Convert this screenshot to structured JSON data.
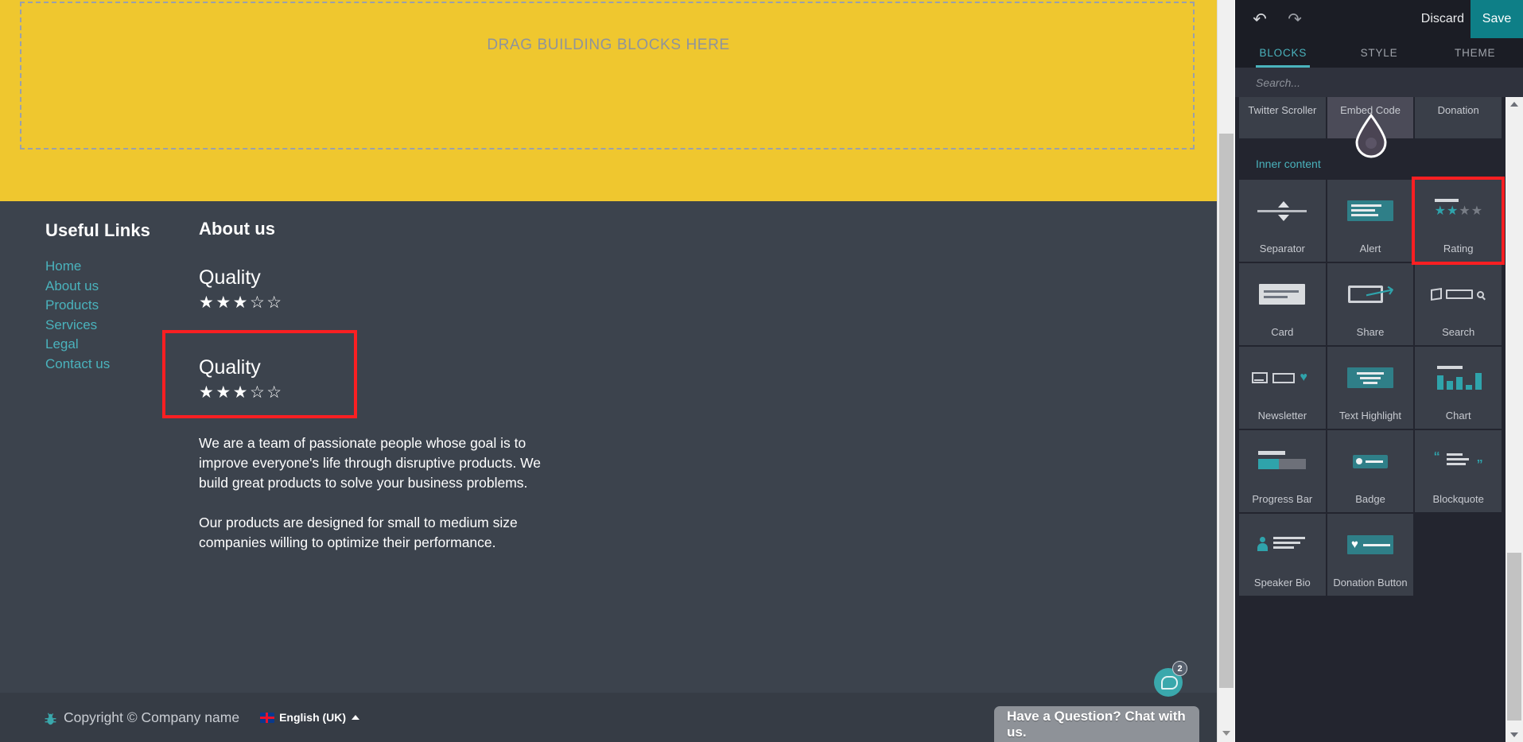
{
  "editor": {
    "toolbar": {
      "undo_icon": "undo-icon",
      "redo_icon": "redo-icon",
      "discard_label": "Discard",
      "save_label": "Save",
      "save_bg": "#0e7f87"
    },
    "tabs": [
      {
        "label": "BLOCKS",
        "active": true
      },
      {
        "label": "STYLE",
        "active": false
      },
      {
        "label": "THEME",
        "active": false
      }
    ],
    "search": {
      "placeholder": "Search...",
      "value": ""
    },
    "accent_color": "#4ab3bd",
    "panel_bg": "#23252f",
    "tile_bg": "#3a3f49",
    "highlight_color": "#fa1f22",
    "groups": [
      {
        "title": "",
        "clipped": true,
        "blocks": [
          {
            "label": "Twitter Scroller",
            "icon": "twitter-scroller-icon",
            "hovered": false,
            "marked": false
          },
          {
            "label": "Embed Code",
            "icon": "embed-code-icon",
            "hovered": true,
            "marked": false
          },
          {
            "label": "Donation",
            "icon": "donation-icon",
            "hovered": false,
            "marked": false
          }
        ]
      },
      {
        "title": "Inner content",
        "clipped": false,
        "blocks": [
          {
            "label": "Separator",
            "icon": "separator-icon",
            "hovered": false,
            "marked": false
          },
          {
            "label": "Alert",
            "icon": "alert-icon",
            "hovered": false,
            "marked": false
          },
          {
            "label": "Rating",
            "icon": "rating-icon",
            "hovered": false,
            "marked": true
          },
          {
            "label": "Card",
            "icon": "card-icon",
            "hovered": false,
            "marked": false
          },
          {
            "label": "Share",
            "icon": "share-icon",
            "hovered": false,
            "marked": false
          },
          {
            "label": "Search",
            "icon": "search-block-icon",
            "hovered": false,
            "marked": false
          },
          {
            "label": "Newsletter",
            "icon": "newsletter-icon",
            "hovered": false,
            "marked": false
          },
          {
            "label": "Text Highlight",
            "icon": "text-highlight-icon",
            "hovered": false,
            "marked": false
          },
          {
            "label": "Chart",
            "icon": "chart-icon",
            "hovered": false,
            "marked": false
          },
          {
            "label": "Progress Bar",
            "icon": "progress-bar-icon",
            "hovered": false,
            "marked": false
          },
          {
            "label": "Badge",
            "icon": "badge-icon",
            "hovered": false,
            "marked": false
          },
          {
            "label": "Blockquote",
            "icon": "blockquote-icon",
            "hovered": false,
            "marked": false
          },
          {
            "label": "Speaker Bio",
            "icon": "speaker-bio-icon",
            "hovered": false,
            "marked": false
          },
          {
            "label": "Donation Button",
            "icon": "donation-button-icon",
            "hovered": false,
            "marked": false
          }
        ]
      }
    ]
  },
  "canvas": {
    "dropzone": {
      "label": "DRAG BUILDING BLOCKS HERE",
      "bg": "#efc72f"
    },
    "footer": {
      "bg": "#3c434d",
      "links_column": {
        "heading": "Useful Links",
        "links": [
          "Home",
          "About us",
          "Products",
          "Services",
          "Legal",
          "Contact us"
        ],
        "link_color": "#4ab3bd"
      },
      "about_column": {
        "heading": "About us",
        "ratings": [
          {
            "title": "Quality",
            "filled": 3,
            "total": 5,
            "highlighted": false
          },
          {
            "title": "Quality",
            "filled": 3,
            "total": 5,
            "highlighted": true
          }
        ],
        "paragraphs": [
          "We are a team of passionate people whose goal is to improve everyone's life through disruptive products. We build great products to solve your business problems.",
          "Our products are designed for small to medium size companies willing to optimize their performance."
        ]
      },
      "copyright": {
        "icon": "bug-icon",
        "text": "Copyright © Company name",
        "language": "English (UK)",
        "language_flag": "uk-flag-icon",
        "caret": "chevron-up-icon"
      }
    },
    "chat": {
      "tooltip": "Have a Question? Chat with us.",
      "badge_count": "2",
      "bubble_color": "#3aa8ac"
    }
  }
}
